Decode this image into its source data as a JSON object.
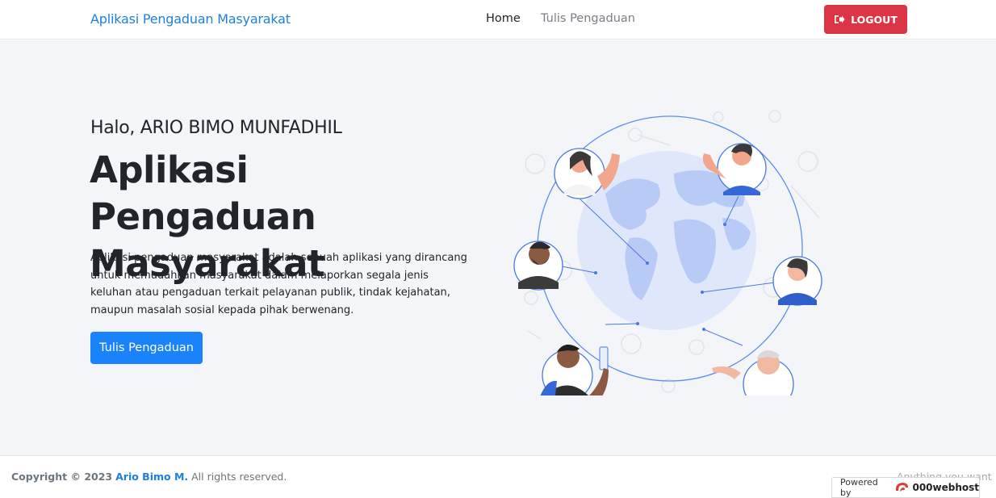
{
  "navbar": {
    "brand": "Aplikasi Pengaduan Masyarakat",
    "links": [
      {
        "label": "Home"
      },
      {
        "label": "Tulis Pengaduan"
      }
    ],
    "logout_label": "LOGOUT"
  },
  "hero": {
    "greeting": "Halo, ARIO BIMO MUNFADHIL",
    "title": "Aplikasi Pengaduan Masyarakat",
    "description": "Aplikasi pengaduan masyarakat adalah sebuah aplikasi yang dirancang untuk memudahkan masyarakat dalam melaporkan segala jenis keluhan atau pengaduan terkait pelayanan publik, tindak kejahatan, maupun masalah sosial kepada pihak berwenang.",
    "cta_label": "Tulis Pengaduan"
  },
  "footer": {
    "copyright_prefix": "Copyright © 2023",
    "author": "Ario Bimo M.",
    "rights": "All rights reserved.",
    "tagline": "Anything you want",
    "powered_by": "Powered by",
    "host_name": "000webhost"
  },
  "colors": {
    "brand": "#1e7fe0",
    "logout": "#dc3545",
    "cta": "#1a82fb",
    "hero_bg": "#f4f5f9"
  },
  "icons": [
    "sign-out-icon",
    "globe-network-illustration",
    "webhost-logo-icon"
  ]
}
